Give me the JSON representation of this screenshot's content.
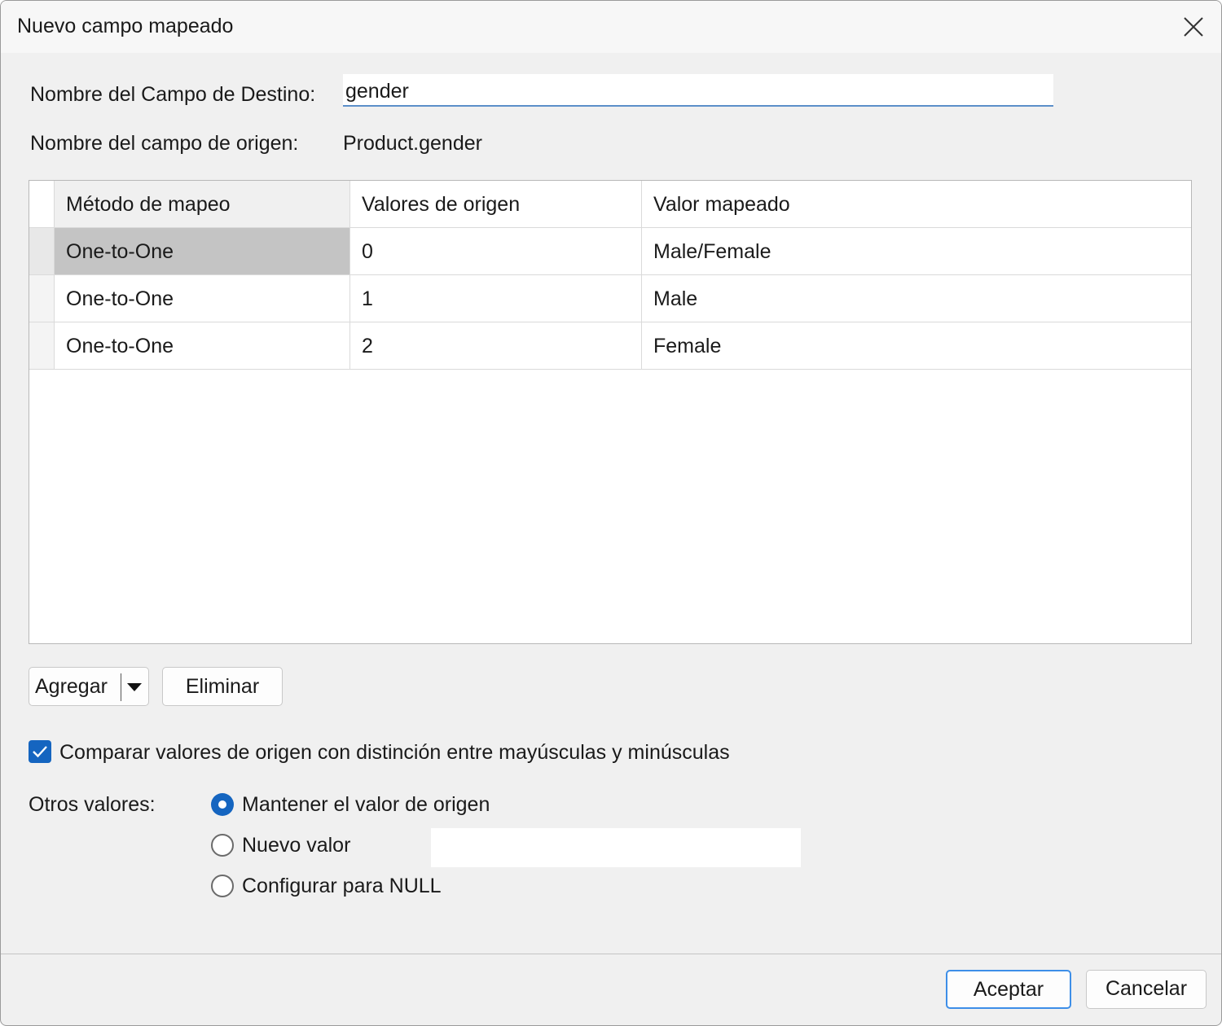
{
  "window": {
    "title": "Nuevo campo mapeado",
    "close_icon": "close-icon"
  },
  "target_field": {
    "label": "Nombre del Campo de Destino:",
    "value": "gender"
  },
  "source_field": {
    "label": "Nombre del campo de origen:",
    "value": "Product.gender"
  },
  "grid": {
    "columns": [
      "Método de mapeo",
      "Valores de origen",
      "Valor mapeado"
    ],
    "rows": [
      {
        "method": "One-to-One",
        "source": "0",
        "mapped": "Male/Female"
      },
      {
        "method": "One-to-One",
        "source": "1",
        "mapped": "Male"
      },
      {
        "method": "One-to-One",
        "source": "2",
        "mapped": "Female"
      }
    ]
  },
  "actions": {
    "add_label": "Agregar",
    "add_dropdown_icon": "caret-down-icon",
    "delete_label": "Eliminar"
  },
  "case_sensitive": {
    "label": "Comparar valores de origen con distinción entre mayúsculas y minúsculas",
    "checked": true
  },
  "other_values": {
    "label": "Otros valores:",
    "options": [
      {
        "label": "Mantener el valor de origen",
        "checked": true
      },
      {
        "label": "Nuevo valor",
        "checked": false
      },
      {
        "label": "Configurar para NULL",
        "checked": false
      }
    ],
    "new_value": ""
  },
  "footer": {
    "ok_label": "Aceptar",
    "cancel_label": "Cancelar"
  },
  "colors": {
    "accent": "#1565c0",
    "focus_border": "#3d8ee8",
    "dialog_bg": "#f0f0f0",
    "selected_cell": "#c4c4c4"
  }
}
